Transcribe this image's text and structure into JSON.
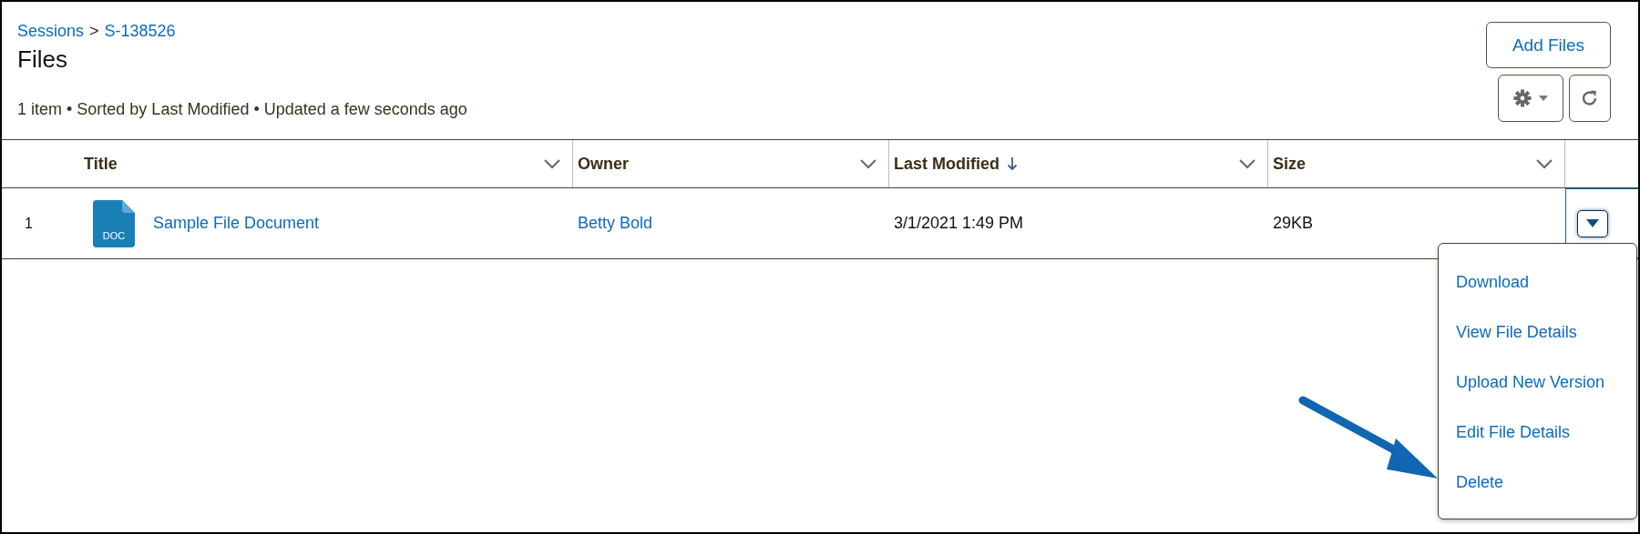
{
  "breadcrumb": {
    "items": [
      {
        "label": "Sessions"
      },
      {
        "label": "S-138526"
      }
    ],
    "separator": ">"
  },
  "title": "Files",
  "meta": "1 item • Sorted by Last Modified • Updated a few seconds ago",
  "add_button": "Add Files",
  "table": {
    "columns": [
      {
        "label": "Title",
        "sorted": false
      },
      {
        "label": "Owner",
        "sorted": false
      },
      {
        "label": "Last Modified",
        "sorted": true
      },
      {
        "label": "Size",
        "sorted": false
      }
    ],
    "rows": [
      {
        "number": "1",
        "title": "Sample File Document",
        "file_type": "DOC",
        "owner": "Betty Bold",
        "last_modified": "3/1/2021 1:49 PM",
        "size": "29KB",
        "menu_open": true
      }
    ]
  },
  "row_menu": {
    "items": [
      {
        "label": "Download"
      },
      {
        "label": "View File Details"
      },
      {
        "label": "Upload New Version"
      },
      {
        "label": "Edit File Details"
      },
      {
        "label": "Delete"
      }
    ]
  },
  "annotation": {
    "kind": "arrow"
  }
}
